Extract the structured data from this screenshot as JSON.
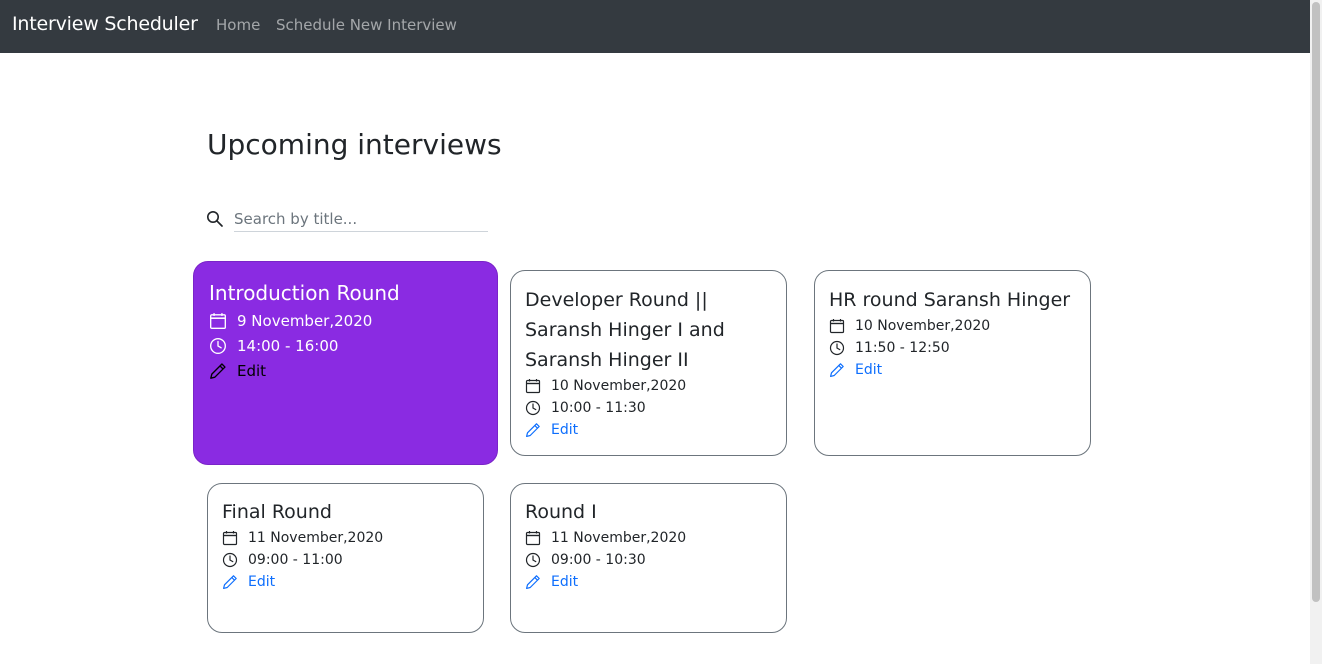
{
  "navbar": {
    "brand": "Interview Scheduler",
    "links": [
      "Home",
      "Schedule New Interview"
    ]
  },
  "page": {
    "title": "Upcoming interviews"
  },
  "search": {
    "placeholder": "Search by title..."
  },
  "cards": [
    {
      "title": "Introduction Round",
      "date": "9 November,2020",
      "time": "14:00 - 16:00",
      "edit": "Edit",
      "selected": true
    },
    {
      "title": "Developer Round || Saransh Hinger I and Saransh Hinger II",
      "date": "10 November,2020",
      "time": "10:00 - 11:30",
      "edit": "Edit"
    },
    {
      "title": "HR round Saransh Hinger",
      "date": "10 November,2020",
      "time": "11:50 - 12:50",
      "edit": "Edit"
    },
    {
      "title": "Final Round",
      "date": "11 November,2020",
      "time": "09:00 - 11:00",
      "edit": "Edit"
    },
    {
      "title": "Round I",
      "date": "11 November,2020",
      "time": "09:00 - 10:30",
      "edit": "Edit"
    }
  ],
  "icons": {
    "search": "search-icon",
    "date": "calendar-icon",
    "time": "clock-icon",
    "edit": "pencil-icon"
  },
  "colors": {
    "navbar": "#343a40",
    "selected_card": "#8a2be2",
    "link": "#0d6efd"
  }
}
